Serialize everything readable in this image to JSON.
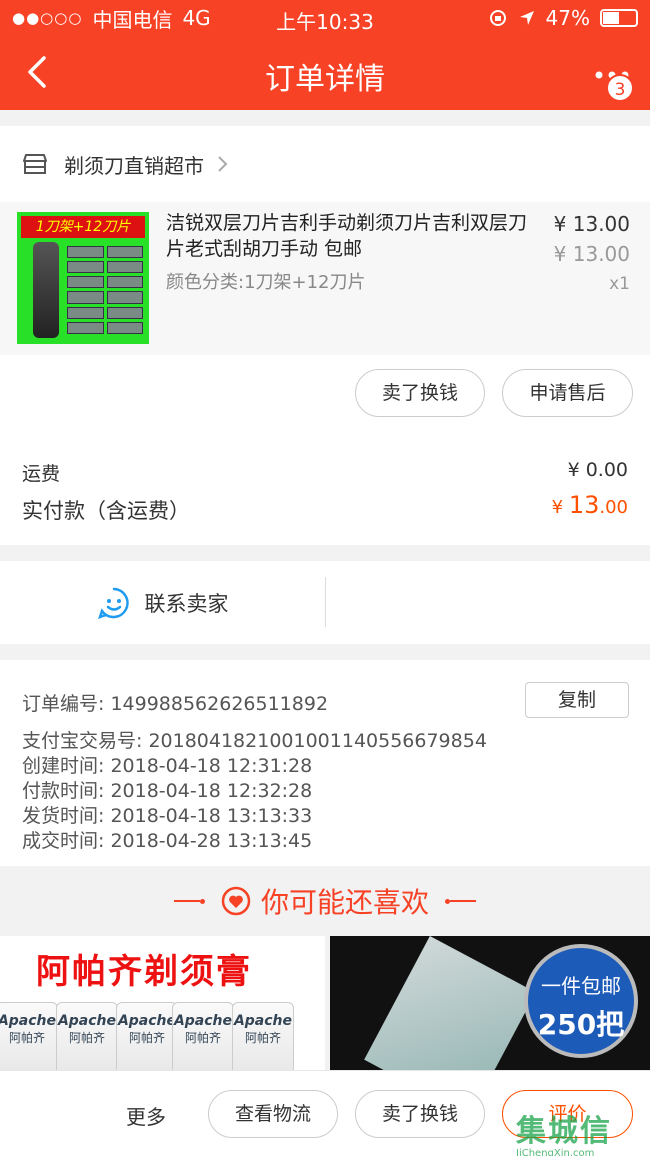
{
  "status_bar": {
    "signal": "●●○○○",
    "carrier": "中国电信",
    "network": "4G",
    "time": "上午10:33",
    "battery": "47%",
    "battery_level": 0.47
  },
  "nav": {
    "title": "订单详情",
    "more_badge": "3"
  },
  "shop": {
    "name": "剃须刀直销超市"
  },
  "item": {
    "thumb_banner": "1刀架+12刀片",
    "title": "洁锐双层刀片吉利手动剃须刀片吉利双层刀片老式刮胡刀手动 包邮",
    "sku": "颜色分类:1刀架+12刀片",
    "price": "¥ 13.00",
    "original_price": "¥ 13.00",
    "quantity": "x1",
    "actions": [
      "卖了换钱",
      "申请售后"
    ]
  },
  "cost": {
    "shipping_label": "运费",
    "shipping_value": "¥ 0.00",
    "paid_label": "实付款（含运费）",
    "paid_currency": "¥ ",
    "paid_int": "13",
    "paid_dec": ".00"
  },
  "contact": {
    "label": "联系卖家"
  },
  "order_info": {
    "order_no": "订单编号:   14998856262651189 2",
    "copy_label": "复制",
    "lines": [
      "订单编号:   149988562626511892",
      "支付宝交易号:   2018041821001001140556679854",
      "创建时间:   2018-04-18 12:31:28",
      "付款时间:   2018-04-18 12:32:28",
      "发货时间:   2018-04-18 13:13:33",
      "成交时间:   2018-04-28 13:13:45"
    ]
  },
  "recommend": {
    "title": "你可能还喜欢",
    "product1_title": "阿帕齐剃须膏",
    "tube_brand": "Apache",
    "tube_sub": "阿帕齐",
    "product2_badge_line1": "一件包邮",
    "product2_badge_line2": "250把"
  },
  "bottom_bar": {
    "more": "更多",
    "logistics": "查看物流",
    "sell": "卖了换钱",
    "review": "评价"
  },
  "watermark": {
    "logo": "集城信",
    "url": "JiChengXin.com"
  },
  "colors": {
    "brand": "#f74226",
    "price_accent": "#ff5000"
  }
}
